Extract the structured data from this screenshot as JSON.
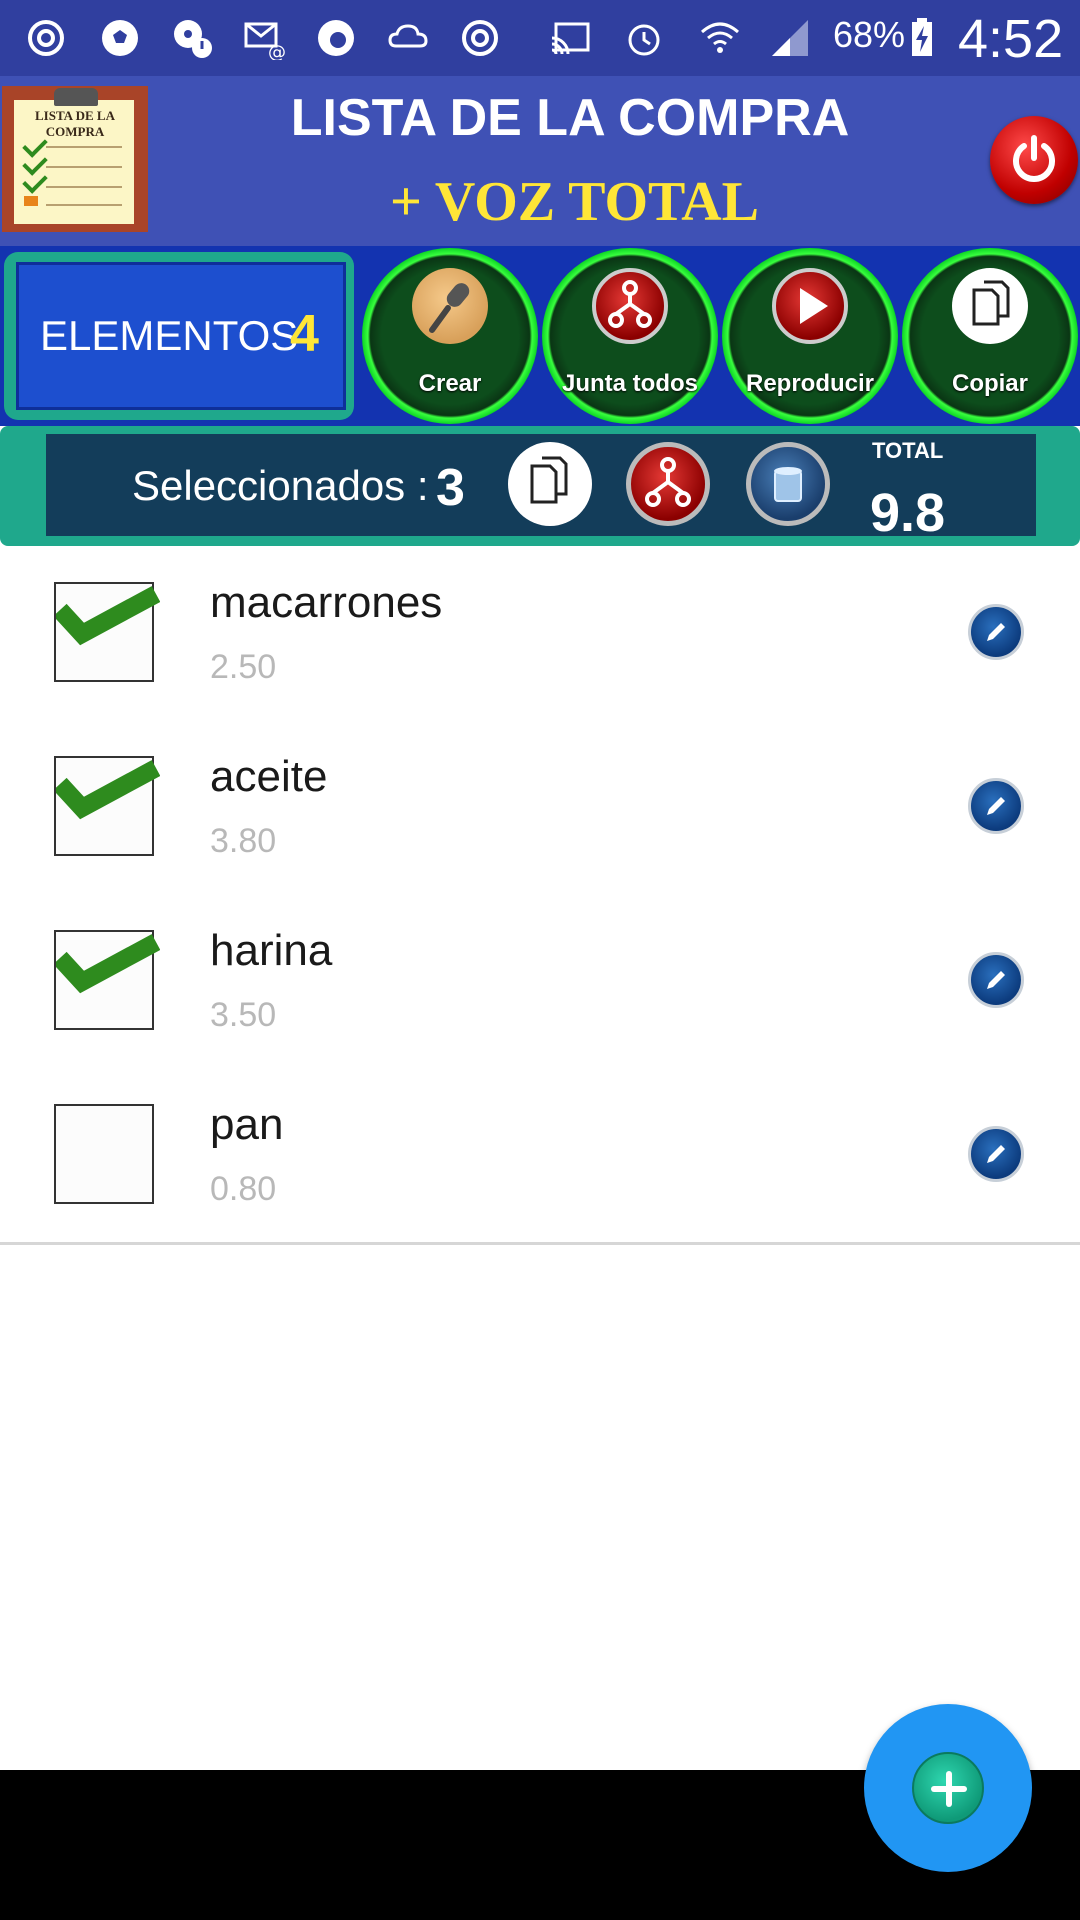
{
  "status_bar": {
    "battery_percent": "68%",
    "time": "4:52",
    "icons": [
      "sync-icon",
      "soccer-ball-icon",
      "alert-disc-icon",
      "email-at-icon",
      "vodafone-icon",
      "cloud-sync-icon",
      "target-sync-icon",
      "cast-icon",
      "alarm-icon",
      "wifi-icon",
      "signal-icon",
      "battery-charging-icon"
    ]
  },
  "header": {
    "title_line1": "LISTA DE LA COMPRA",
    "title_line2": "+ VOZ TOTAL",
    "logo_text": "LISTA DE LA COMPRA"
  },
  "toolbar": {
    "elementos_label": "ELEMENTOS",
    "elementos_count": "4",
    "buttons": [
      {
        "label": "Crear",
        "icon": "microphone-icon"
      },
      {
        "label": "Junta todos",
        "icon": "merge-icon"
      },
      {
        "label": "Reproducir",
        "icon": "play-icon"
      },
      {
        "label": "Copiar",
        "icon": "copy-icon"
      }
    ]
  },
  "selection": {
    "label": "Seleccionados :",
    "count": "3",
    "total_label": "TOTAL",
    "total_value": "9.8"
  },
  "items": [
    {
      "name": "macarrones",
      "price": "2.50",
      "checked": true
    },
    {
      "name": "aceite",
      "price": "3.80",
      "checked": true
    },
    {
      "name": "harina",
      "price": "3.50",
      "checked": true
    },
    {
      "name": "pan",
      "price": "0.80",
      "checked": false
    }
  ],
  "colors": {
    "status_bar": "#303f9f",
    "header": "#3f51b5",
    "title_accent": "#ffe637",
    "check_green": "#2e8b1e",
    "fab": "#2196f3"
  }
}
